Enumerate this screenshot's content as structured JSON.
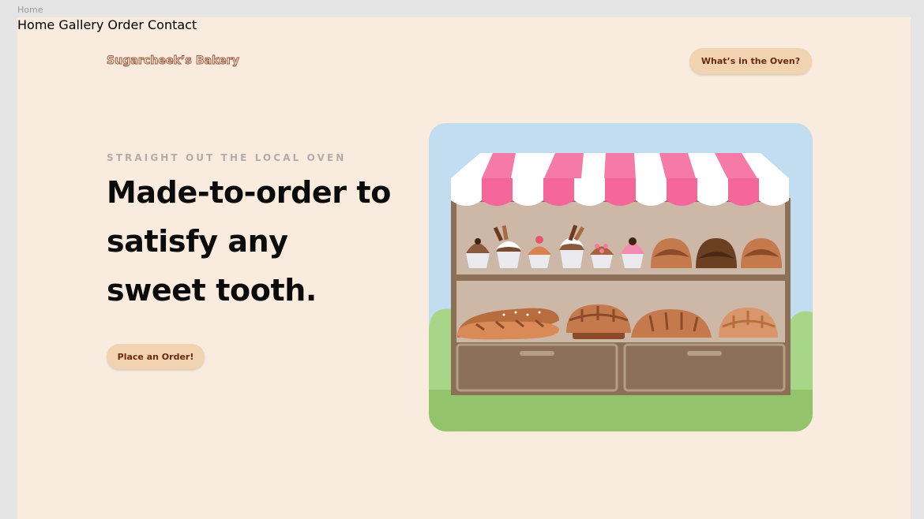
{
  "frame": {
    "label": "Home"
  },
  "header": {
    "logo": "Sugarcheek’s Bakery",
    "nav": [
      "Home",
      "Gallery",
      "Order",
      "Contact"
    ],
    "cta": "What’s in the Oven?"
  },
  "hero": {
    "eyebrow": "STRAIGHT OUT THE LOCAL OVEN",
    "headline": "Made-to-order to satisfy any sweet tooth.",
    "cta": "Place an Order!"
  },
  "colors": {
    "page_bg": "#f9ebdd",
    "button_bg": "#f1d3b1",
    "button_text": "#6a2a12",
    "awning_pink": "#f5679b",
    "sky": "#c2dcf0",
    "grass": "#93c46b"
  }
}
